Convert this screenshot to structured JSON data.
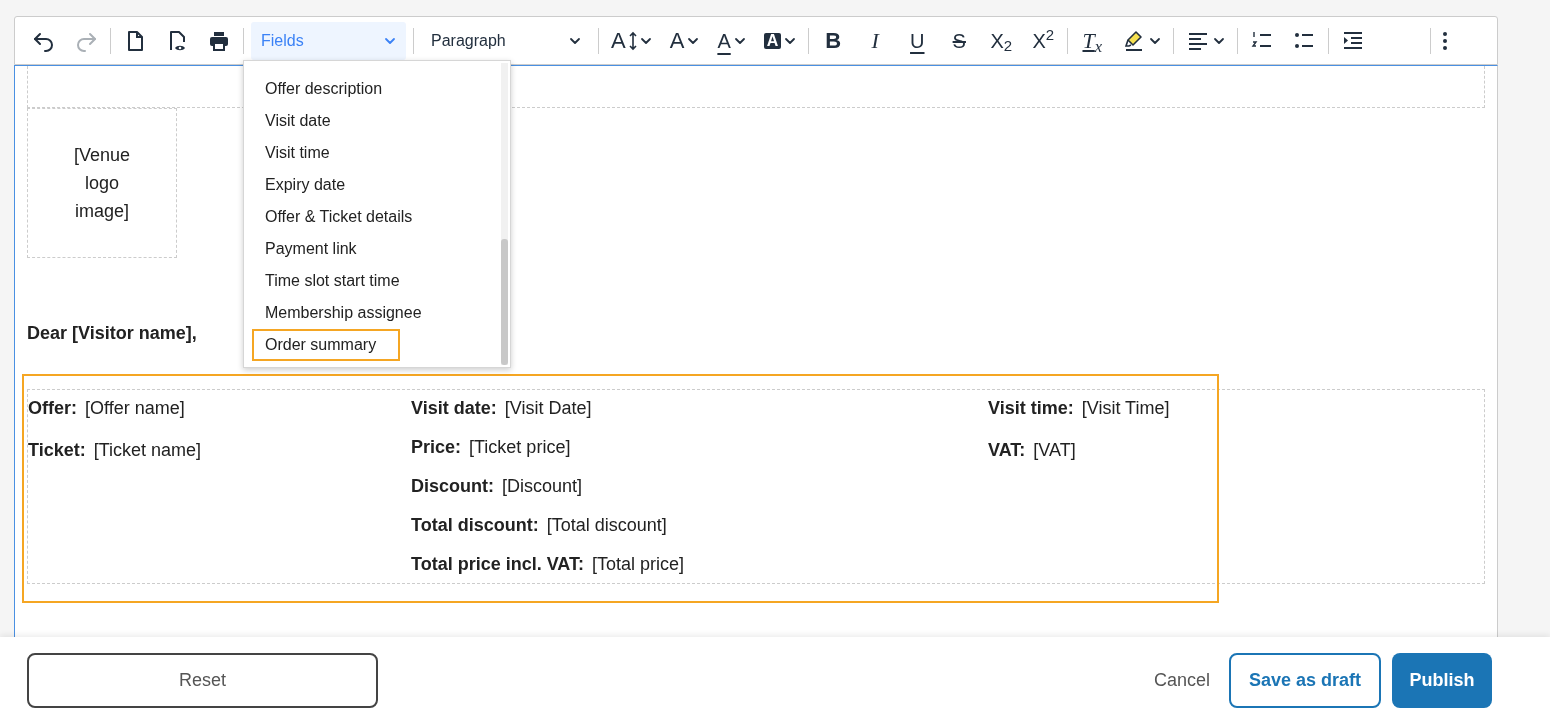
{
  "toolbar": {
    "groups": [
      [
        {
          "kind": "undo",
          "disabled": false
        },
        {
          "kind": "redo",
          "disabled": true
        }
      ],
      [
        {
          "kind": "new-document"
        },
        {
          "kind": "preview"
        },
        {
          "kind": "print"
        }
      ],
      [
        {
          "kind": "dropdown",
          "label": "Fields",
          "open": true
        }
      ],
      [
        {
          "kind": "dropdown",
          "label": "Paragraph",
          "open": false
        }
      ],
      [
        {
          "kind": "font-size",
          "glyph": "A",
          "caret": true
        },
        {
          "kind": "font-family",
          "glyph": "A",
          "caret": true
        },
        {
          "kind": "text-color",
          "glyph": "A",
          "caret": true
        },
        {
          "kind": "background-color",
          "glyph": "A",
          "caret": true
        }
      ],
      [
        {
          "kind": "bold",
          "glyph": "B"
        },
        {
          "kind": "italic",
          "glyph": "I"
        },
        {
          "kind": "underline",
          "glyph": "U"
        },
        {
          "kind": "strikethrough",
          "glyph": "S"
        },
        {
          "kind": "subscript",
          "glyph": "X$_{2}$"
        },
        {
          "kind": "superscript",
          "glyph": "X$^{2}$"
        }
      ],
      [
        {
          "kind": "clear-format",
          "glyph": "T$_{x}$"
        },
        {
          "kind": "highlight",
          "caret": true
        }
      ],
      [
        {
          "kind": "align",
          "caret": true
        }
      ],
      [
        {
          "kind": "ordered-list"
        },
        {
          "kind": "bullet-list"
        }
      ],
      [
        {
          "kind": "indent"
        }
      ],
      [
        {
          "kind": "more"
        }
      ]
    ]
  },
  "fields_menu": {
    "items": [
      {
        "label": "Offer description",
        "selected": false
      },
      {
        "label": "Visit date",
        "selected": false
      },
      {
        "label": "Visit time",
        "selected": false
      },
      {
        "label": "Expiry date",
        "selected": false
      },
      {
        "label": "Offer & Ticket details",
        "selected": false
      },
      {
        "label": "Payment link",
        "selected": false
      },
      {
        "label": "Time slot start time",
        "selected": false
      },
      {
        "label": "Membership assignee",
        "selected": false
      },
      {
        "label": "Order summary",
        "selected": true
      }
    ]
  },
  "document": {
    "logo_placeholder": "[Venue logo image]",
    "greeting": "Dear [Visitor name],",
    "order_summary": {
      "selected": true,
      "columns": [
        [
          {
            "label": "Offer:",
            "value": "[Offer name]"
          },
          {
            "label": "Ticket:",
            "value": "[Ticket name]"
          }
        ],
        [
          {
            "label": "Visit date:",
            "value": "[Visit Date]"
          },
          {
            "label": "Price:",
            "value": "[Ticket price]"
          },
          {
            "label": "Discount:",
            "value": "[Discount]"
          },
          {
            "label": "Total discount:",
            "value": "[Total discount]"
          },
          {
            "label": "Total price incl. VAT:",
            "value": "[Total price]"
          }
        ],
        [
          {
            "label": "Visit time:",
            "value": "[Visit Time]"
          },
          {
            "label": "VAT:",
            "value": "[VAT]"
          }
        ]
      ]
    }
  },
  "footer": {
    "buttons": [
      {
        "kind": "secondary",
        "label": "Reset"
      },
      {
        "kind": "link",
        "label": "Cancel"
      },
      {
        "kind": "outline",
        "label": "Save as draft"
      },
      {
        "kind": "primary",
        "label": "Publish"
      }
    ]
  }
}
